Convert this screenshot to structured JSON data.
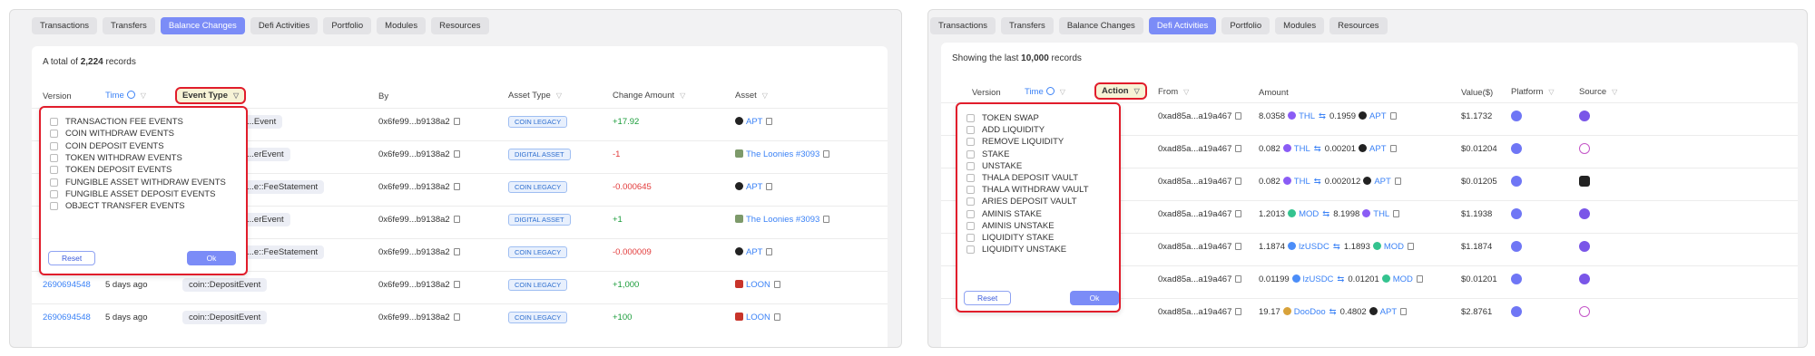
{
  "left": {
    "tabs": [
      "Transactions",
      "Transfers",
      "Balance Changes",
      "Defi Activities",
      "Portfolio",
      "Modules",
      "Resources"
    ],
    "active_tab": "Balance Changes",
    "summary": {
      "prefix": "A total of",
      "count": "2,224",
      "suffix": "records"
    },
    "headers": {
      "version": "Version",
      "time": "Time",
      "event_type": "Event Type",
      "by": "By",
      "asset_type": "Asset Type",
      "change_amount": "Change Amount",
      "asset": "Asset"
    },
    "rows": [
      {
        "version": "",
        "age": "",
        "event": "...Event",
        "by": "0x6fe99...b9138a2",
        "asset_type": "COIN LEGACY",
        "change": "+17.92",
        "change_sign": "green",
        "asset": "APT",
        "asset_icon": "c-dark"
      },
      {
        "version": "",
        "age": "",
        "event": "...erEvent",
        "by": "0x6fe99...b9138a2",
        "asset_type": "DIGITAL ASSET",
        "change": "-1",
        "change_sign": "red",
        "asset": "The Loonies #3093",
        "asset_icon": "c-img"
      },
      {
        "version": "",
        "age": "",
        "event": "...e::FeeStatement",
        "by": "0x6fe99...b9138a2",
        "asset_type": "COIN LEGACY",
        "change": "-0.000645",
        "change_sign": "red",
        "asset": "APT",
        "asset_icon": "c-dark"
      },
      {
        "version": "",
        "age": "",
        "event": "...erEvent",
        "by": "0x6fe99...b9138a2",
        "asset_type": "DIGITAL ASSET",
        "change": "+1",
        "change_sign": "green",
        "asset": "The Loonies #3093",
        "asset_icon": "c-img"
      },
      {
        "version": "",
        "age": "",
        "event": "...e::FeeStatement",
        "by": "0x6fe99...b9138a2",
        "asset_type": "COIN LEGACY",
        "change": "-0.000009",
        "change_sign": "red",
        "asset": "APT",
        "asset_icon": "c-dark"
      },
      {
        "version": "2690694548",
        "age": "5 days ago",
        "event": "coin::DepositEvent",
        "by": "0x6fe99...b9138a2",
        "asset_type": "COIN LEGACY",
        "change": "+1,000",
        "change_sign": "green",
        "asset": "LOON",
        "asset_icon": "c-red"
      },
      {
        "version": "2690694548",
        "age": "5 days ago",
        "event": "coin::DepositEvent",
        "by": "0x6fe99...b9138a2",
        "asset_type": "COIN LEGACY",
        "change": "+100",
        "change_sign": "green",
        "asset": "LOON",
        "asset_icon": "c-red"
      }
    ],
    "filter": {
      "options": [
        "TRANSACTION FEE EVENTS",
        "COIN WITHDRAW EVENTS",
        "COIN DEPOSIT EVENTS",
        "TOKEN WITHDRAW EVENTS",
        "TOKEN DEPOSIT EVENTS",
        "FUNGIBLE ASSET WITHDRAW EVENTS",
        "FUNGIBLE ASSET DEPOSIT EVENTS",
        "OBJECT TRANSFER EVENTS"
      ],
      "reset": "Reset",
      "ok": "Ok"
    }
  },
  "right": {
    "tabs": [
      "Transactions",
      "Transfers",
      "Balance Changes",
      "Defi Activities",
      "Portfolio",
      "Modules",
      "Resources"
    ],
    "active_tab": "Defi Activities",
    "summary": {
      "prefix": "Showing the last",
      "count": "10,000",
      "suffix": "records"
    },
    "headers": {
      "version": "Version",
      "time": "Time",
      "action": "Action",
      "from": "From",
      "amount": "Amount",
      "value": "Value($)",
      "platform": "Platform",
      "source": "Source"
    },
    "rows": [
      {
        "from": "0xad85a...a19a467",
        "amt1": "8.0358",
        "tok1": "THL",
        "tok1_icon": "c-purple",
        "amt2": "0.1959",
        "tok2": "APT",
        "tok2_icon": "c-dark",
        "value": "$1.1732",
        "source_icon": "src-a"
      },
      {
        "from": "0xad85a...a19a467",
        "amt1": "0.082",
        "tok1": "THL",
        "tok1_icon": "c-purple",
        "amt2": "0.00201",
        "tok2": "APT",
        "tok2_icon": "c-dark",
        "value": "$0.01204",
        "source_icon": "src-b"
      },
      {
        "from": "0xad85a...a19a467",
        "amt1": "0.082",
        "tok1": "THL",
        "tok1_icon": "c-purple",
        "amt2": "0.002012",
        "tok2": "APT",
        "tok2_icon": "c-dark",
        "value": "$0.01205",
        "source_icon": "src-c"
      },
      {
        "from": "0xad85a...a19a467",
        "amt1": "1.2013",
        "tok1": "MOD",
        "tok1_icon": "c-green",
        "amt2": "8.1998",
        "tok2": "THL",
        "tok2_icon": "c-purple",
        "value": "$1.1938",
        "source_icon": "src-a"
      },
      {
        "from": "0xad85a...a19a467",
        "amt1": "1.1874",
        "tok1": "lzUSDC",
        "tok1_icon": "c-blue",
        "amt2": "1.1893",
        "tok2": "MOD",
        "tok2_icon": "c-green",
        "value": "$1.1874",
        "source_icon": "src-a"
      },
      {
        "from": "0xad85a...a19a467",
        "amt1": "0.01199",
        "tok1": "lzUSDC",
        "tok1_icon": "c-blue",
        "amt2": "0.01201",
        "tok2": "MOD",
        "tok2_icon": "c-green",
        "value": "$0.01201",
        "source_icon": "src-a"
      },
      {
        "from": "0xad85a...a19a467",
        "amt1": "19.17",
        "tok1": "DooDoo",
        "tok1_icon": "c-gold",
        "amt2": "0.4802",
        "tok2": "APT",
        "tok2_icon": "c-dark",
        "value": "$2.8761",
        "source_icon": "src-b"
      }
    ],
    "filter": {
      "options": [
        "TOKEN SWAP",
        "ADD LIQUIDITY",
        "REMOVE LIQUIDITY",
        "STAKE",
        "UNSTAKE",
        "THALA DEPOSIT VAULT",
        "THALA WITHDRAW VAULT",
        "ARIES DEPOSIT VAULT",
        "AMINIS STAKE",
        "AMINIS UNSTAKE",
        "LIQUIDITY STAKE",
        "LIQUIDITY UNSTAKE"
      ],
      "reset": "Reset",
      "ok": "Ok"
    }
  },
  "colors": {
    "accent": "#7b8cf7",
    "highlight_border": "#e11d2b",
    "link": "#3b82f6",
    "positive": "#1a9c3a",
    "negative": "#e23a3a"
  }
}
